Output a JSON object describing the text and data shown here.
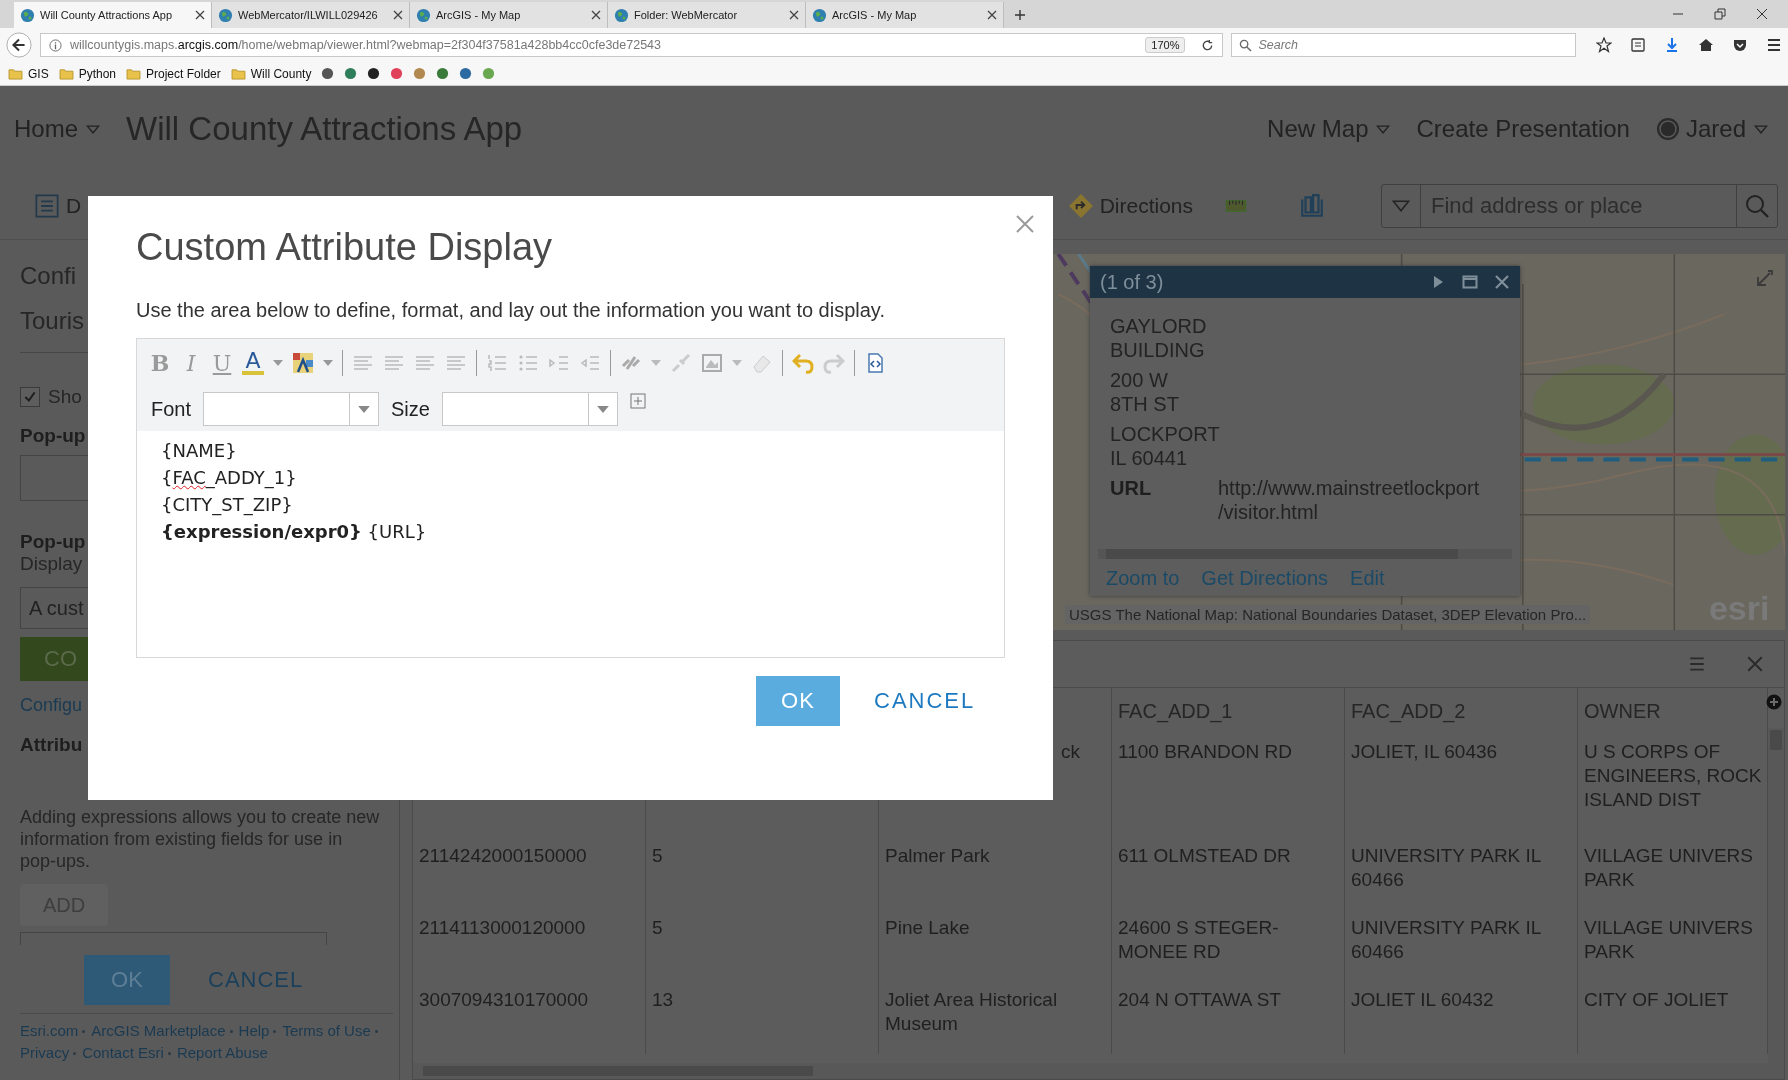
{
  "browser": {
    "tabs": [
      {
        "title": "Will County Attractions App",
        "selected": true
      },
      {
        "title": "WebMercator/ILWILL029426",
        "selected": false
      },
      {
        "title": "ArcGIS - My Map",
        "selected": false
      },
      {
        "title": "Folder: WebMercator",
        "selected": false
      },
      {
        "title": "ArcGIS - My Map",
        "selected": false
      }
    ],
    "url": {
      "subdomain": "willcountygis.maps.",
      "domain": "arcgis.com",
      "path": "/home/webmap/viewer.html?webmap=2f304f37581a428bb4cc0cfe3de72543"
    },
    "zoom": "170%",
    "search_placeholder": "Search",
    "bookmarks": [
      {
        "kind": "folder",
        "label": "GIS"
      },
      {
        "kind": "folder",
        "label": "Python"
      },
      {
        "kind": "folder",
        "label": "Project Folder"
      },
      {
        "kind": "folder",
        "label": "Will County"
      },
      {
        "kind": "site",
        "color": "#555555"
      },
      {
        "kind": "site",
        "color": "#2e7d5b"
      },
      {
        "kind": "site",
        "color": "#222222"
      },
      {
        "kind": "site",
        "color": "#e0405a"
      },
      {
        "kind": "site",
        "color": "#b08850"
      },
      {
        "kind": "site",
        "color": "#3a7a3a"
      },
      {
        "kind": "site",
        "color": "#2a6aa0"
      },
      {
        "kind": "site",
        "color": "#6aa84f"
      }
    ]
  },
  "header": {
    "home": "Home",
    "title": "Will County Attractions App",
    "new_map": "New Map",
    "create_presentation": "Create Presentation",
    "user": "Jared"
  },
  "toolbar": {
    "details": "D",
    "directions": "Directions",
    "search_placeholder": "Find address or place"
  },
  "left_panel": {
    "heading_1": "Confi",
    "heading_2": "Touris",
    "show_checkbox": {
      "label": "Sho",
      "checked": true
    },
    "popup_title_label": "Pop-up",
    "popup_contents_label": "Pop-up",
    "display_label": "Display",
    "display_select": "A cust",
    "configure_button": "CO",
    "configure_link": "Configu",
    "attributes_heading": "Attribu",
    "attributes_text": "Adding expressions allows you to create new information from existing fields for use in pop-ups.",
    "add_button": "ADD",
    "ok": "OK",
    "cancel": "CANCEL",
    "footer_links": [
      "Esri.com",
      "ArcGIS Marketplace",
      "Help",
      "Terms of Use",
      "Privacy",
      "Contact Esri",
      "Report Abuse"
    ]
  },
  "map": {
    "popup": {
      "counter": "(1 of 3)",
      "address_blocks": [
        [
          "GAYLORD",
          "BUILDING"
        ],
        [
          "200 W",
          "8TH ST"
        ],
        [
          "LOCKPORT",
          "IL 60441"
        ]
      ],
      "url_label": "URL",
      "url_lines": [
        "http://www.mainstreetlockport",
        "/visitor.html"
      ],
      "actions": [
        "Zoom to",
        "Get Directions",
        "Edit"
      ]
    },
    "attribution": "USGS The National Map: National Boundaries Dataset, 3DEP Elevation Pro...",
    "logo": "esri"
  },
  "table": {
    "columns": [
      null,
      null,
      null,
      "FAC_ADD_1",
      "FAC_ADD_2",
      "OWNER"
    ],
    "rows": [
      {
        "cells": [
          null,
          null,
          "ck",
          "1100 BRANDON RD",
          "JOLIET, IL 60436",
          "U S CORPS OF\nENGINEERS, ROCK\nISLAND DIST"
        ]
      },
      {
        "cells": [
          "2114242000150000",
          "5",
          "Palmer Park",
          "611 OLMSTEAD DR",
          "UNIVERSITY PARK IL\n60466",
          "VILLAGE UNIVERS\nPARK"
        ]
      },
      {
        "cells": [
          "2114113000120000",
          "5",
          "Pine Lake",
          "24600 S STEGER-\nMONEE RD",
          "UNIVERSITY PARK IL\n60466",
          "VILLAGE UNIVERS\nPARK"
        ]
      },
      {
        "cells": [
          "3007094310170000",
          "13",
          "Joliet Area Historical\nMuseum",
          "204 N OTTAWA ST",
          "JOLIET IL 60432",
          "CITY OF JOLIET"
        ]
      }
    ]
  },
  "dialog": {
    "title": "Custom Attribute Display",
    "description": "Use the area below to define, format, and lay out the information you want to display.",
    "format": {
      "bold": "B",
      "italic": "I",
      "underline": "U",
      "text_color": "A"
    },
    "font_label": "Font",
    "size_label": "Size",
    "lines": [
      {
        "segments": [
          {
            "text": "{NAME}",
            "bold": false,
            "misspelled": false
          }
        ]
      },
      {
        "segments": [
          {
            "text": "{",
            "bold": false,
            "misspelled": false
          },
          {
            "text": "FAC",
            "bold": false,
            "misspelled": true
          },
          {
            "text": "_ADDY_1}",
            "bold": false,
            "misspelled": false
          }
        ]
      },
      {
        "segments": [
          {
            "text": "{CITY_ST_ZIP}",
            "bold": false,
            "misspelled": false
          }
        ]
      },
      {
        "segments": [
          {
            "text": "{expression/expr0}",
            "bold": true,
            "misspelled": false
          },
          {
            "text": " {URL}",
            "bold": false,
            "misspelled": false
          }
        ]
      }
    ],
    "ok": "OK",
    "cancel": "CANCEL"
  }
}
